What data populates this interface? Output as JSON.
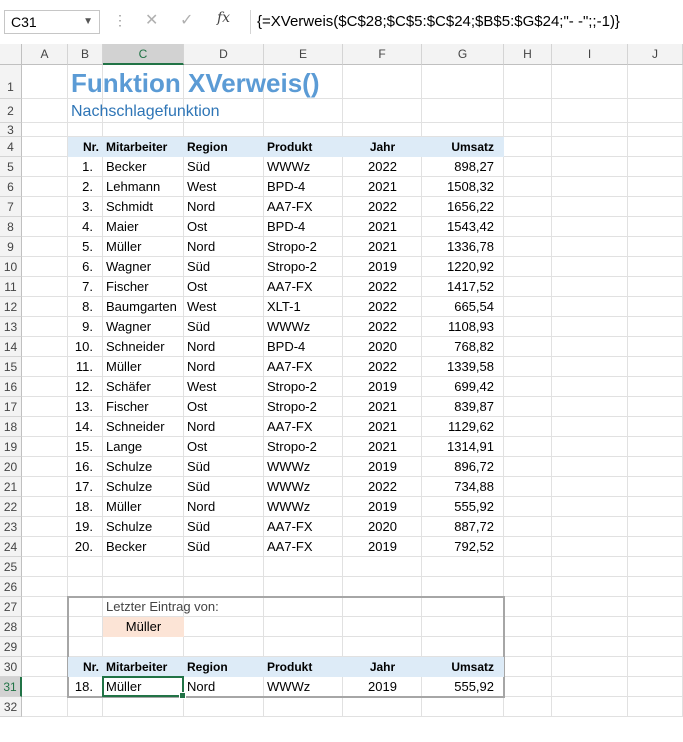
{
  "name_box": "C31",
  "formula": "{=XVerweis($C$28;$C$5:$C$24;$B$5:$G$24;\"- -\";;-1)}",
  "columns": [
    "A",
    "B",
    "C",
    "D",
    "E",
    "F",
    "G",
    "H",
    "I",
    "J"
  ],
  "rows": [
    "1",
    "2",
    "3",
    "4",
    "5",
    "6",
    "7",
    "8",
    "9",
    "10",
    "11",
    "12",
    "13",
    "14",
    "15",
    "16",
    "17",
    "18",
    "19",
    "20",
    "21",
    "22",
    "23",
    "24",
    "25",
    "26",
    "27",
    "28",
    "29",
    "30",
    "31",
    "32"
  ],
  "title": "Funktion XVerweis()",
  "subtitle": "Nachschlagefunktion",
  "table_headers": [
    "Nr.",
    "Mitarbeiter",
    "Region",
    "Produkt",
    "Jahr",
    "Umsatz"
  ],
  "table_rows": [
    [
      "1.",
      "Becker",
      "Süd",
      "WWWz",
      "2022",
      "898,27"
    ],
    [
      "2.",
      "Lehmann",
      "West",
      "BPD-4",
      "2021",
      "1508,32"
    ],
    [
      "3.",
      "Schmidt",
      "Nord",
      "AA7-FX",
      "2022",
      "1656,22"
    ],
    [
      "4.",
      "Maier",
      "Ost",
      "BPD-4",
      "2021",
      "1543,42"
    ],
    [
      "5.",
      "Müller",
      "Nord",
      "Stropo-2",
      "2021",
      "1336,78"
    ],
    [
      "6.",
      "Wagner",
      "Süd",
      "Stropo-2",
      "2019",
      "1220,92"
    ],
    [
      "7.",
      "Fischer",
      "Ost",
      "AA7-FX",
      "2022",
      "1417,52"
    ],
    [
      "8.",
      "Baumgarten",
      "West",
      "XLT-1",
      "2022",
      "665,54"
    ],
    [
      "9.",
      "Wagner",
      "Süd",
      "WWWz",
      "2022",
      "1108,93"
    ],
    [
      "10.",
      "Schneider",
      "Nord",
      "BPD-4",
      "2020",
      "768,82"
    ],
    [
      "11.",
      "Müller",
      "Nord",
      "AA7-FX",
      "2022",
      "1339,58"
    ],
    [
      "12.",
      "Schäfer",
      "West",
      "Stropo-2",
      "2019",
      "699,42"
    ],
    [
      "13.",
      "Fischer",
      "Ost",
      "Stropo-2",
      "2021",
      "839,87"
    ],
    [
      "14.",
      "Schneider",
      "Nord",
      "AA7-FX",
      "2021",
      "1129,62"
    ],
    [
      "15.",
      "Lange",
      "Ost",
      "Stropo-2",
      "2021",
      "1314,91"
    ],
    [
      "16.",
      "Schulze",
      "Süd",
      "WWWz",
      "2019",
      "896,72"
    ],
    [
      "17.",
      "Schulze",
      "Süd",
      "WWWz",
      "2022",
      "734,88"
    ],
    [
      "18.",
      "Müller",
      "Nord",
      "WWWz",
      "2019",
      "555,92"
    ],
    [
      "19.",
      "Schulze",
      "Süd",
      "AA7-FX",
      "2020",
      "887,72"
    ],
    [
      "20.",
      "Becker",
      "Süd",
      "AA7-FX",
      "2019",
      "792,52"
    ]
  ],
  "lookup_label": "Letzter Eintrag von:",
  "lookup_value": "Müller",
  "result_headers": [
    "Nr.",
    "Mitarbeiter",
    "Region",
    "Produkt",
    "Jahr",
    "Umsatz"
  ],
  "result_row": [
    "18.",
    "Müller",
    "Nord",
    "WWWz",
    "2019",
    "555,92"
  ],
  "colors": {
    "title": "#5b9bd5",
    "header_fill": "#ddebf7",
    "lookup_fill": "#fce4d6",
    "selection": "#217346"
  }
}
